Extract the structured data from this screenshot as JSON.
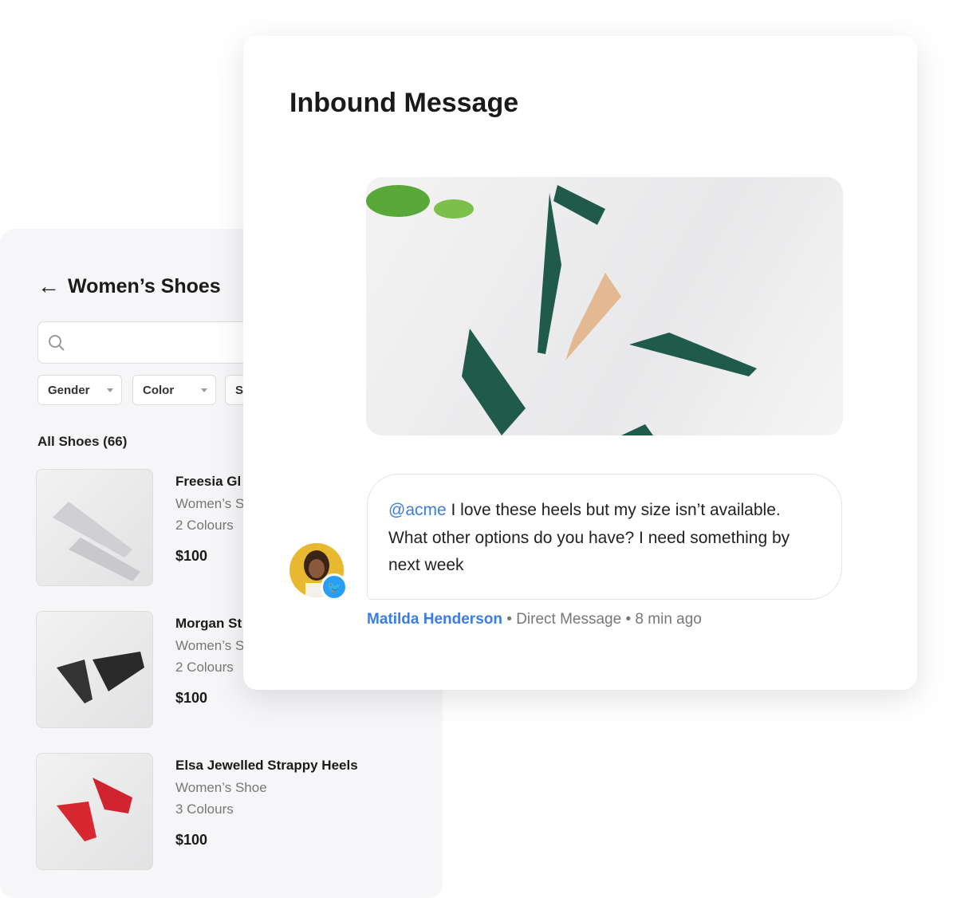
{
  "catalog": {
    "title": "Women’s Shoes",
    "search": {
      "placeholder": ""
    },
    "filters": [
      "Gender",
      "Color",
      "S"
    ],
    "count_label": "All Shoes (66)",
    "products": [
      {
        "name": "Freesia Gl",
        "type": "Women’s S",
        "colours": "2 Colours",
        "price": "$100"
      },
      {
        "name": "Morgan St",
        "type": "Women’s S",
        "colours": "2 Colours",
        "price": "$100"
      },
      {
        "name": "Elsa Jewelled Strappy Heels",
        "type": "Women’s Shoe",
        "colours": "3 Colours",
        "price": "$100"
      }
    ]
  },
  "message": {
    "title": "Inbound Message",
    "mention": "@acme",
    "text": " I love these heels but my size isn’t available. What other options do you have? I need something by next week",
    "author": "Matilda Henderson",
    "channel": "Direct Message",
    "time": "8 min ago",
    "separator": "•"
  },
  "colors": {
    "accent": "#3b7de0",
    "twitter": "#2a9ef0",
    "shoe_green": "#1f5a4a"
  }
}
